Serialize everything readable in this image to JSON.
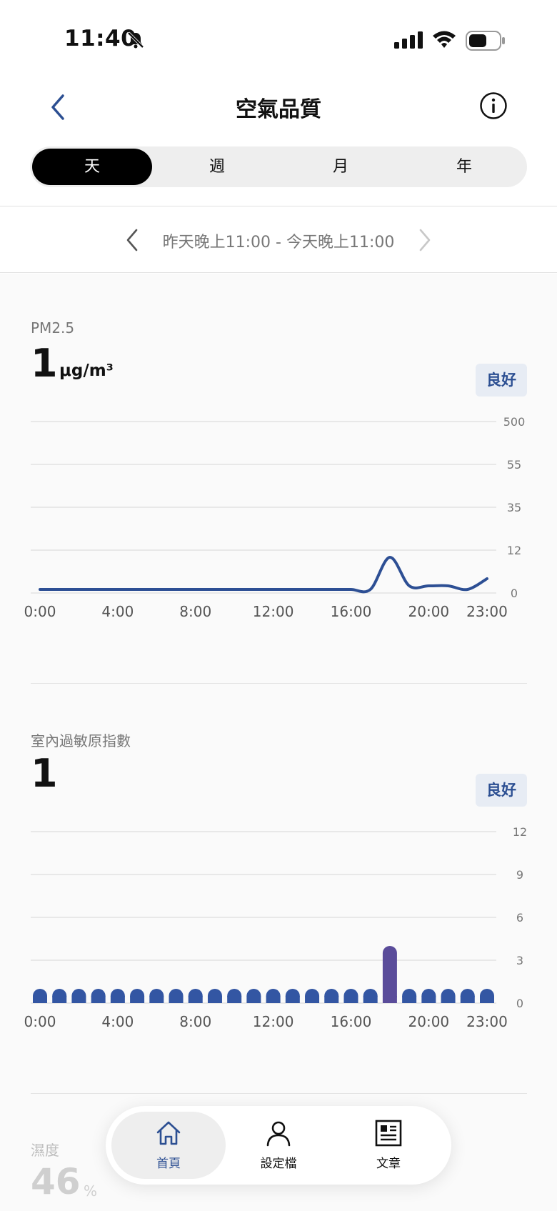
{
  "status_bar": {
    "time": "11:40"
  },
  "nav": {
    "title": "空氣品質"
  },
  "segments": [
    "天",
    "週",
    "月",
    "年"
  ],
  "active_segment": 0,
  "date_range": "昨天晚上11:00 - 今天晚上11:00",
  "pm25": {
    "label": "PM2.5",
    "value": "1",
    "unit": "μg/m³",
    "status": "良好"
  },
  "allergen": {
    "label": "室內過敏原指數",
    "value": "1",
    "status": "良好"
  },
  "humidity": {
    "label": "濕度",
    "value": "46",
    "unit": "%"
  },
  "tabs": [
    {
      "label": "首頁",
      "icon": "home-icon"
    },
    {
      "label": "設定檔",
      "icon": "user-icon"
    },
    {
      "label": "文章",
      "icon": "article-icon"
    }
  ],
  "active_tab": 0,
  "colors": {
    "accent": "#2c4f92",
    "line": "#2d4f94",
    "bar": "#3356a3",
    "bar_highlight": "#5a4c9a"
  },
  "chart_data": [
    {
      "type": "line",
      "title": "PM2.5",
      "y_tick_labels": [
        "0",
        "12",
        "35",
        "55",
        "500"
      ],
      "x_tick_labels": [
        "0:00",
        "4:00",
        "8:00",
        "12:00",
        "16:00",
        "20:00",
        "23:00"
      ],
      "x": [
        "0:00",
        "1:00",
        "2:00",
        "3:00",
        "4:00",
        "5:00",
        "6:00",
        "7:00",
        "8:00",
        "9:00",
        "10:00",
        "11:00",
        "12:00",
        "13:00",
        "14:00",
        "15:00",
        "16:00",
        "17:00",
        "18:00",
        "19:00",
        "20:00",
        "21:00",
        "22:00",
        "23:00"
      ],
      "values": [
        1,
        1,
        1,
        1,
        1,
        1,
        1,
        1,
        1,
        1,
        1,
        1,
        1,
        1,
        1,
        1,
        1,
        1,
        10,
        2,
        2,
        2,
        1,
        4
      ],
      "scale": "piecewise (bands 0-12, 12-35, 35-55, 55-500)",
      "grid": true
    },
    {
      "type": "bar",
      "title": "室內過敏原指數",
      "y_tick_labels": [
        "0",
        "3",
        "6",
        "9",
        "12"
      ],
      "ylim": [
        0,
        12
      ],
      "x_tick_labels": [
        "0:00",
        "4:00",
        "8:00",
        "12:00",
        "16:00",
        "20:00",
        "23:00"
      ],
      "categories": [
        "0:00",
        "1:00",
        "2:00",
        "3:00",
        "4:00",
        "5:00",
        "6:00",
        "7:00",
        "8:00",
        "9:00",
        "10:00",
        "11:00",
        "12:00",
        "13:00",
        "14:00",
        "15:00",
        "16:00",
        "17:00",
        "18:00",
        "19:00",
        "20:00",
        "21:00",
        "22:00",
        "23:00"
      ],
      "values": [
        1,
        1,
        1,
        1,
        1,
        1,
        1,
        1,
        1,
        1,
        1,
        1,
        1,
        1,
        1,
        1,
        1,
        1,
        4,
        1,
        1,
        1,
        1,
        1
      ],
      "highlight_index": 18,
      "grid": true
    }
  ]
}
